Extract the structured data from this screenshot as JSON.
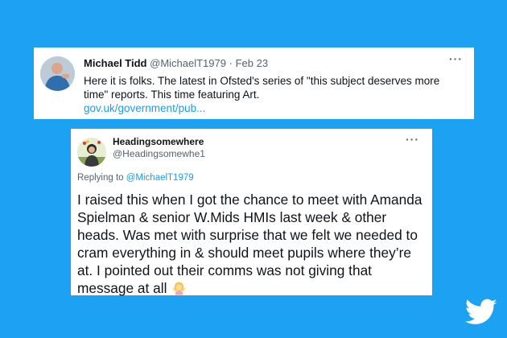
{
  "tweet1": {
    "author_name": "Michael Tidd",
    "handle": "@MichaelT1979",
    "date": "Feb 23",
    "separator": "·",
    "text": "Here it is folks. The latest in Ofsted's series of \"this subject deserves more time\" reports. This time featuring Art.",
    "link": "gov.uk/government/pub...",
    "more_label": "···"
  },
  "tweet2": {
    "author_name": "Headingsomewhere",
    "handle": "@Headingsomewhe1",
    "replying_prefix": "Replying to ",
    "replying_handle": "@MichaelT1979",
    "text": "I raised this when I got the chance to meet with Amanda Spielman & senior W.Mids HMIs last week & other heads. Was met with surprise that we felt we needed to cram everything in & should meet pupils where they’re at. I pointed out their comms was not giving that message at all",
    "emoji": "person-shrugging-emoji",
    "more_label": "···"
  },
  "colors": {
    "background": "#1da1f2",
    "link": "#1d9bf0",
    "text": "#0f1419",
    "muted": "#536471"
  },
  "icons": {
    "brand": "twitter-bird-icon",
    "overflow": "more-options-icon"
  }
}
